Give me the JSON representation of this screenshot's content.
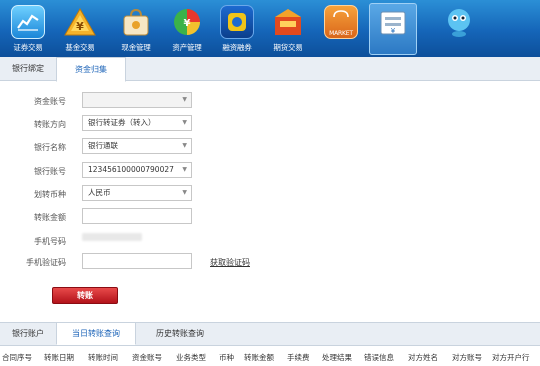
{
  "toolbar": {
    "items": [
      {
        "label": "证券交易",
        "icon": "chart-icon"
      },
      {
        "label": "基金交易",
        "icon": "fund-icon"
      },
      {
        "label": "现金管理",
        "icon": "cash-bag-icon"
      },
      {
        "label": "资产管理",
        "icon": "pie-chart-icon"
      },
      {
        "label": "融资融券",
        "icon": "margin-icon"
      },
      {
        "label": "期货交易",
        "icon": "futures-box-icon"
      },
      {
        "label": "",
        "icon": "market-icon"
      },
      {
        "label": "",
        "icon": "bank-transfer-icon"
      },
      {
        "label": "",
        "icon": "assistant-icon"
      }
    ],
    "market_text": "MARKET"
  },
  "tabs_top": [
    "银行绑定",
    "资金归集"
  ],
  "form": {
    "account_label": "资金账号",
    "direction_label": "转账方向",
    "direction_value": "银行转证券（转入）",
    "bank_name_label": "银行名称",
    "bank_name_value": "银行通联",
    "bank_account_label": "银行账号",
    "bank_account_value": "123456100000790027",
    "currency_label": "划转币种",
    "currency_value": "人民币",
    "amount_label": "转账金额",
    "phone_label": "手机号码",
    "code_label": "手机验证码",
    "get_code_link": "获取验证码",
    "submit_label": "转账"
  },
  "tabs_bottom": [
    "银行账户",
    "当日转账查询",
    "历史转账查询"
  ],
  "table_headers": [
    "合同序号",
    "转账日期",
    "转账时间",
    "资金账号",
    "业务类型",
    "币种",
    "转账金额",
    "手续费",
    "处理结果",
    "错误信息",
    "对方姓名",
    "对方账号",
    "对方开户行"
  ]
}
